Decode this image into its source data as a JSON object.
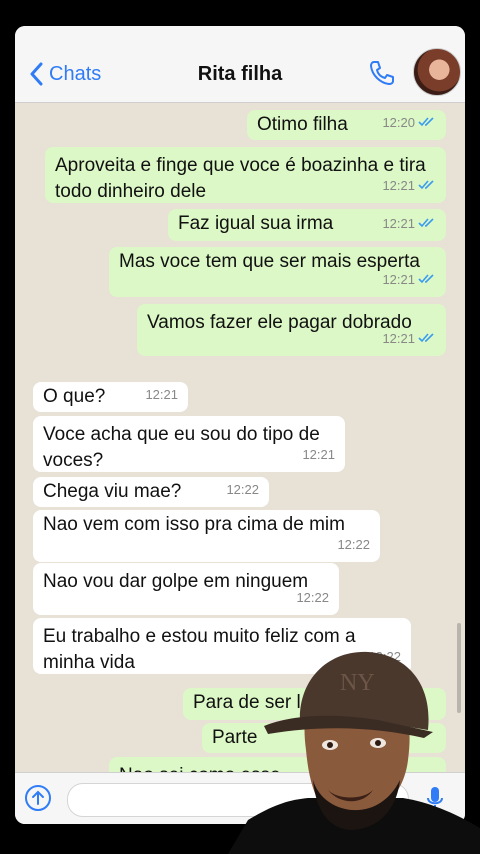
{
  "header": {
    "back_label": "Chats",
    "title": "Rita filha"
  },
  "messages": [
    {
      "dir": "out",
      "text": "Otimo filha",
      "time": "12:20"
    },
    {
      "dir": "out",
      "text": "Aproveita e finge que voce é boazinha e tira todo dinheiro dele",
      "time": "12:21"
    },
    {
      "dir": "out",
      "text": "Faz igual sua irma",
      "time": "12:21"
    },
    {
      "dir": "out",
      "text": "Mas voce tem que ser mais esperta",
      "time": "12:21"
    },
    {
      "dir": "out",
      "text": "Vamos fazer ele pagar dobrado",
      "time": "12:21"
    },
    {
      "dir": "in",
      "text": "O que?",
      "time": "12:21"
    },
    {
      "dir": "in",
      "text": "Voce acha que eu sou do tipo de voces?",
      "time": "12:21"
    },
    {
      "dir": "in",
      "text": "Chega viu mae?",
      "time": "12:22"
    },
    {
      "dir": "in",
      "text": "Nao vem com isso pra cima de mim",
      "time": "12:22"
    },
    {
      "dir": "in",
      "text": "Nao vou dar golpe em ninguem",
      "time": "12:22"
    },
    {
      "dir": "in",
      "text": "Eu trabalho e estou muito feliz com a minha vida",
      "time": "12:22"
    },
    {
      "dir": "out",
      "text": "Para de ser l",
      "time": ""
    },
    {
      "dir": "out",
      "text": "Parte",
      "time": ""
    },
    {
      "dir": "out",
      "text": "Nao sei como esse pra voce",
      "time": ""
    }
  ],
  "colors": {
    "accent": "#2f7cf6",
    "outgoing": "#dcf8c6",
    "incoming": "#ffffff",
    "chat_bg": "#e7e1d6"
  },
  "icons": [
    "chevron-left-icon",
    "phone-icon",
    "upload-icon",
    "mic-icon"
  ]
}
